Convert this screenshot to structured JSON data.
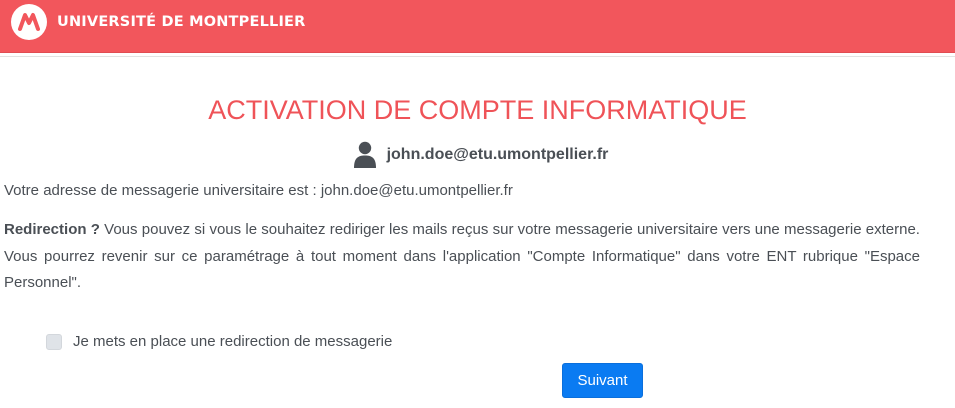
{
  "header": {
    "brand_name": "UNIVERSITÉ DE MONTPELLIER",
    "color": "#f2565c"
  },
  "page_title": "ACTIVATION DE COMPTE INFORMATIQUE",
  "user": {
    "icon": "user-icon",
    "email": "john.doe@etu.umontpellier.fr"
  },
  "info_text": "Votre adresse de messagerie universitaire est : john.doe@etu.umontpellier.fr",
  "redirection": {
    "lead": "Redirection ?",
    "text": " Vous pouvez si vous le souhaitez rediriger les mails reçus sur votre messagerie universitaire vers une messagerie externe. Vous pourrez revenir sur ce paramétrage à tout moment dans l'application \"Compte Informatique\" dans votre ENT rubrique \"Espace Personnel\"."
  },
  "checkbox": {
    "label": "Je mets en place une redirection de messagerie",
    "checked": false
  },
  "next_button": {
    "label": "Suivant",
    "color": "#0a7bf2"
  }
}
